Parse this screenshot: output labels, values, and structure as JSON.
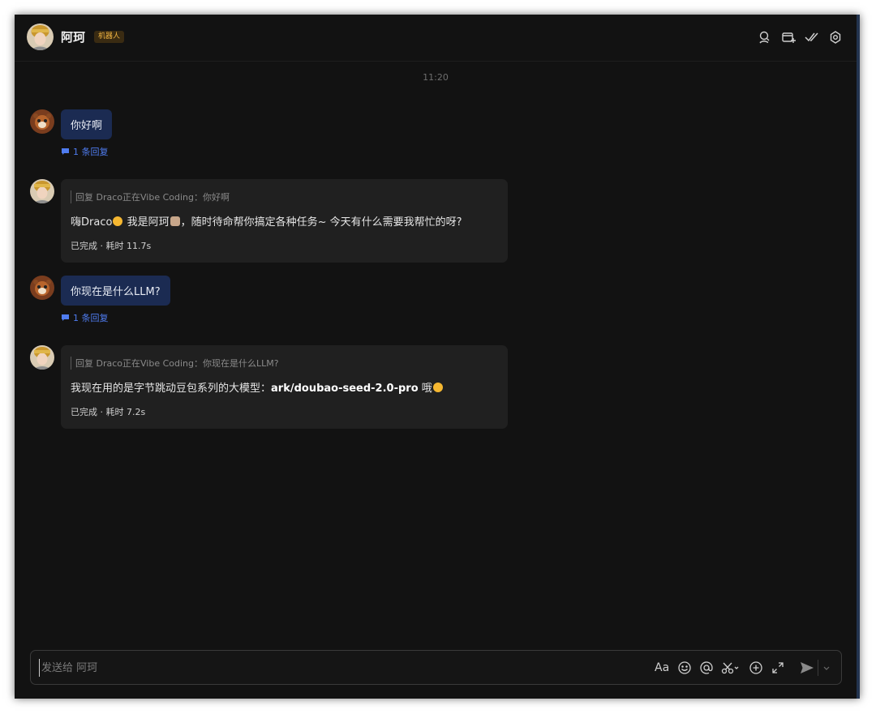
{
  "header": {
    "name": "阿珂",
    "badge": "机器人",
    "icons": [
      "search-icon",
      "add-tab-icon",
      "done-icon",
      "settings-icon"
    ]
  },
  "chat": {
    "timestamp": "11:20",
    "messages": [
      {
        "text": "你好啊",
        "reply_count": "1 条回复"
      },
      {
        "quote": "回复 Draco正在Vibe Coding：你好啊",
        "text_a": "嗨Draco",
        "text_b": " 我是阿珂",
        "text_c": "，随时待命帮你搞定各种任务~ 今天有什么需要我帮忙的呀?",
        "status": "已完成 · 耗时 11.7s"
      },
      {
        "text": "你现在是什么LLM?",
        "reply_count": "1 条回复"
      },
      {
        "quote": "回复 Draco正在Vibe Coding：你现在是什么LLM?",
        "text_a": "我现在用的是字节跳动豆包系列的大模型：",
        "text_bold": "ark/doubao-seed-2.0-pro",
        "text_c": " 哦",
        "status": "已完成 · 耗时 7.2s"
      }
    ]
  },
  "composer": {
    "placeholder": "发送给 阿珂",
    "font_button": "Aa",
    "toolbar_icons": [
      "font-icon",
      "emoji-icon",
      "mention-icon",
      "scissors-icon",
      "plus-circle-icon",
      "expand-icon",
      "send-icon",
      "chevron-down-icon"
    ]
  },
  "colors": {
    "background": "#121212",
    "user_bubble": "#1b2b52",
    "bot_card": "#202020",
    "link": "#4f7cf0",
    "badge_text": "#f0b441"
  }
}
